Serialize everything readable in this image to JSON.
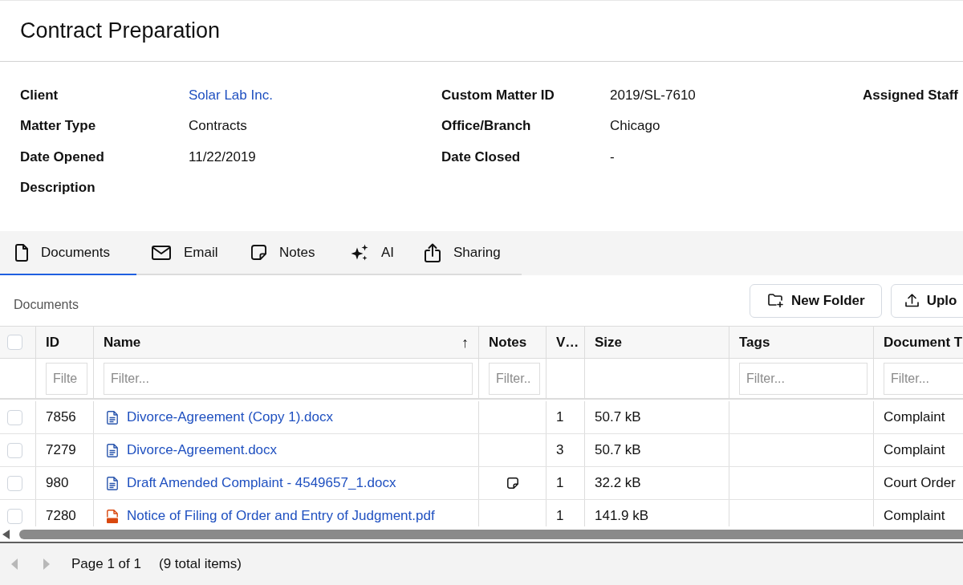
{
  "page_title": "Contract Preparation",
  "details": [
    [
      {
        "label": "Client",
        "value": "Solar Lab Inc.",
        "kind": "link"
      },
      {
        "label": "Custom Matter ID",
        "value": "2019/SL-7610",
        "kind": "text"
      },
      {
        "label": "Assigned Staff"
      }
    ],
    [
      {
        "label": "Matter Type",
        "value": "Contracts",
        "kind": "text"
      },
      {
        "label": "Office/Branch",
        "value": "Chicago",
        "kind": "text"
      }
    ],
    [
      {
        "label": "Date Opened",
        "value": "11/22/2019",
        "kind": "text"
      },
      {
        "label": "Date Closed",
        "value": "-",
        "kind": "text"
      }
    ],
    [
      {
        "label": "Description"
      }
    ]
  ],
  "tabs": [
    {
      "label": "Documents",
      "selected": true
    },
    {
      "label": "Email",
      "selected": false
    },
    {
      "label": "Notes",
      "selected": false
    },
    {
      "label": "AI",
      "selected": false
    },
    {
      "label": "Sharing",
      "selected": false
    }
  ],
  "documents": {
    "heading": "Documents",
    "buttons": [
      "New Folder",
      "Uplo"
    ],
    "table": {
      "select_all_checked": false,
      "columns": [
        {
          "label": "ID",
          "filter": {
            "placeholder": "Filte"
          }
        },
        {
          "label": "Name",
          "sort_arrow": "↑",
          "filter": {
            "placeholder": "Filter..."
          }
        },
        {
          "label": "Notes",
          "filter": {
            "placeholder": "Filter.."
          }
        },
        {
          "label": "V…"
        },
        {
          "label": "Size"
        },
        {
          "label": "Tags",
          "filter": {
            "placeholder": "Filter..."
          }
        },
        {
          "label": "Document T",
          "filter": {
            "placeholder": "Filter..."
          }
        }
      ],
      "rows": [
        {
          "checked": false,
          "id": "7856",
          "kind": "word",
          "name": "Divorce-Agreement (Copy 1).docx",
          "note": false,
          "version": "1",
          "size": "50.7 kB",
          "document_type": "Complaint"
        },
        {
          "checked": false,
          "id": "7279",
          "kind": "word",
          "name": "Divorce-Agreement.docx",
          "note": false,
          "version": "3",
          "size": "50.7 kB",
          "document_type": "Complaint"
        },
        {
          "checked": false,
          "id": "980",
          "kind": "word",
          "name": "Draft Amended Complaint - 4549657_1.docx",
          "note": true,
          "version": "1",
          "size": "32.2 kB",
          "document_type": "Court Order"
        },
        {
          "checked": false,
          "id": "7280",
          "kind": "pdf",
          "name": "Notice of Filing of Order and Entry of Judgment.pdf",
          "note": false,
          "version": "1",
          "size": "141.9 kB",
          "document_type": "Complaint"
        }
      ]
    },
    "pager": {
      "previous_disabled": true,
      "next_disabled": true,
      "page_text": "Page 1 of 1",
      "total_text": "(9 total items)"
    }
  }
}
